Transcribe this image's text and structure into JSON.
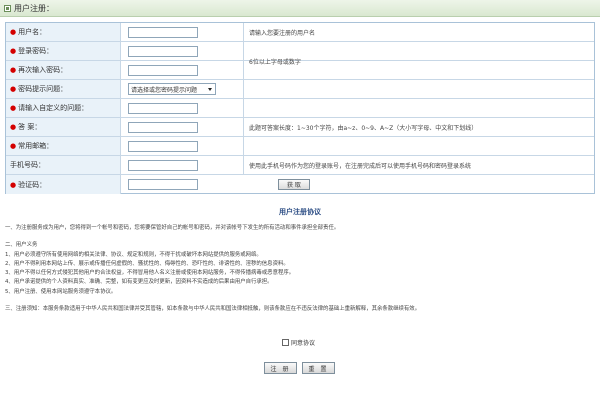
{
  "window": {
    "title": "用户注册："
  },
  "form": {
    "username": {
      "label": "用户名：",
      "value": "",
      "hint": "请输入您要注册的用户名"
    },
    "password": {
      "label": "登录密码：",
      "value": ""
    },
    "password_confirm": {
      "label": "再次输入密码：",
      "value": "",
      "hint": "6位以上字母或数字"
    },
    "question": {
      "label": "密码提示问题：",
      "selected": "请选择或您密码提示问题"
    },
    "custom_question": {
      "label": "请输入自定义的问题：",
      "value": ""
    },
    "answer": {
      "label": "答 案：",
      "value": "",
      "hint": "此题可答案长度：1~30个字符，由a~z、0~9、A~Z（大小写字母、中文和下划线）"
    },
    "email": {
      "label": "常用邮箱：",
      "value": ""
    },
    "phone": {
      "label": "手机号码：",
      "value": "",
      "hint": "使用此手机号码作为您的登录账号，在注册完成后可以使用手机号码和密码登录系统"
    },
    "captcha": {
      "label": "验证码：",
      "value": "",
      "button": "获 取"
    }
  },
  "agreement": {
    "title": "用户注册协议",
    "lines": [
      "一、为注册服务成为用户，您将得到一个帐号和密码，您将要保管好自己的帐号和密码，并对该帐号下发生的所有活动和事件承担全部责任。",
      "二、用户义务",
      "1、用户必须遵守所有使用网络的相关法律、协议、规定和规则，不得干扰或破坏本网站提供的服务或网络。",
      "2、用户不得利用本网站上传、展示或传播任何虚假的、骚扰性的、侮辱性的、恐吓性的、诽谤性的、淫秽的信息资料。",
      "3、用户不得以任何方式侵犯其他用户的合法权益，不得冒用他人名义注册或使用本网站服务，不得传播病毒或恶意程序。",
      "4、用户承诺提供的个人资料真实、准确、完整，如有变更应及时更新，因资料不实造成的后果由用户自行承担。",
      "5、用户注册、使用本网站服务须遵守本协议。",
      "三、注册须知：本服务条款适用于中华人民共和国法律并受其管辖，如本条款与中华人民共和国法律相抵触，则该条款应在不违反法律的基础上重新解释，其余条款继续有效。"
    ]
  },
  "agree_label": "同意协议",
  "buttons": {
    "register": "注 册",
    "reset": "重 置"
  },
  "colors": {
    "required": "#d40000",
    "label_bg": "#e9f2f9",
    "border": "#c7d7e6",
    "title_text": "#2e4f86"
  }
}
